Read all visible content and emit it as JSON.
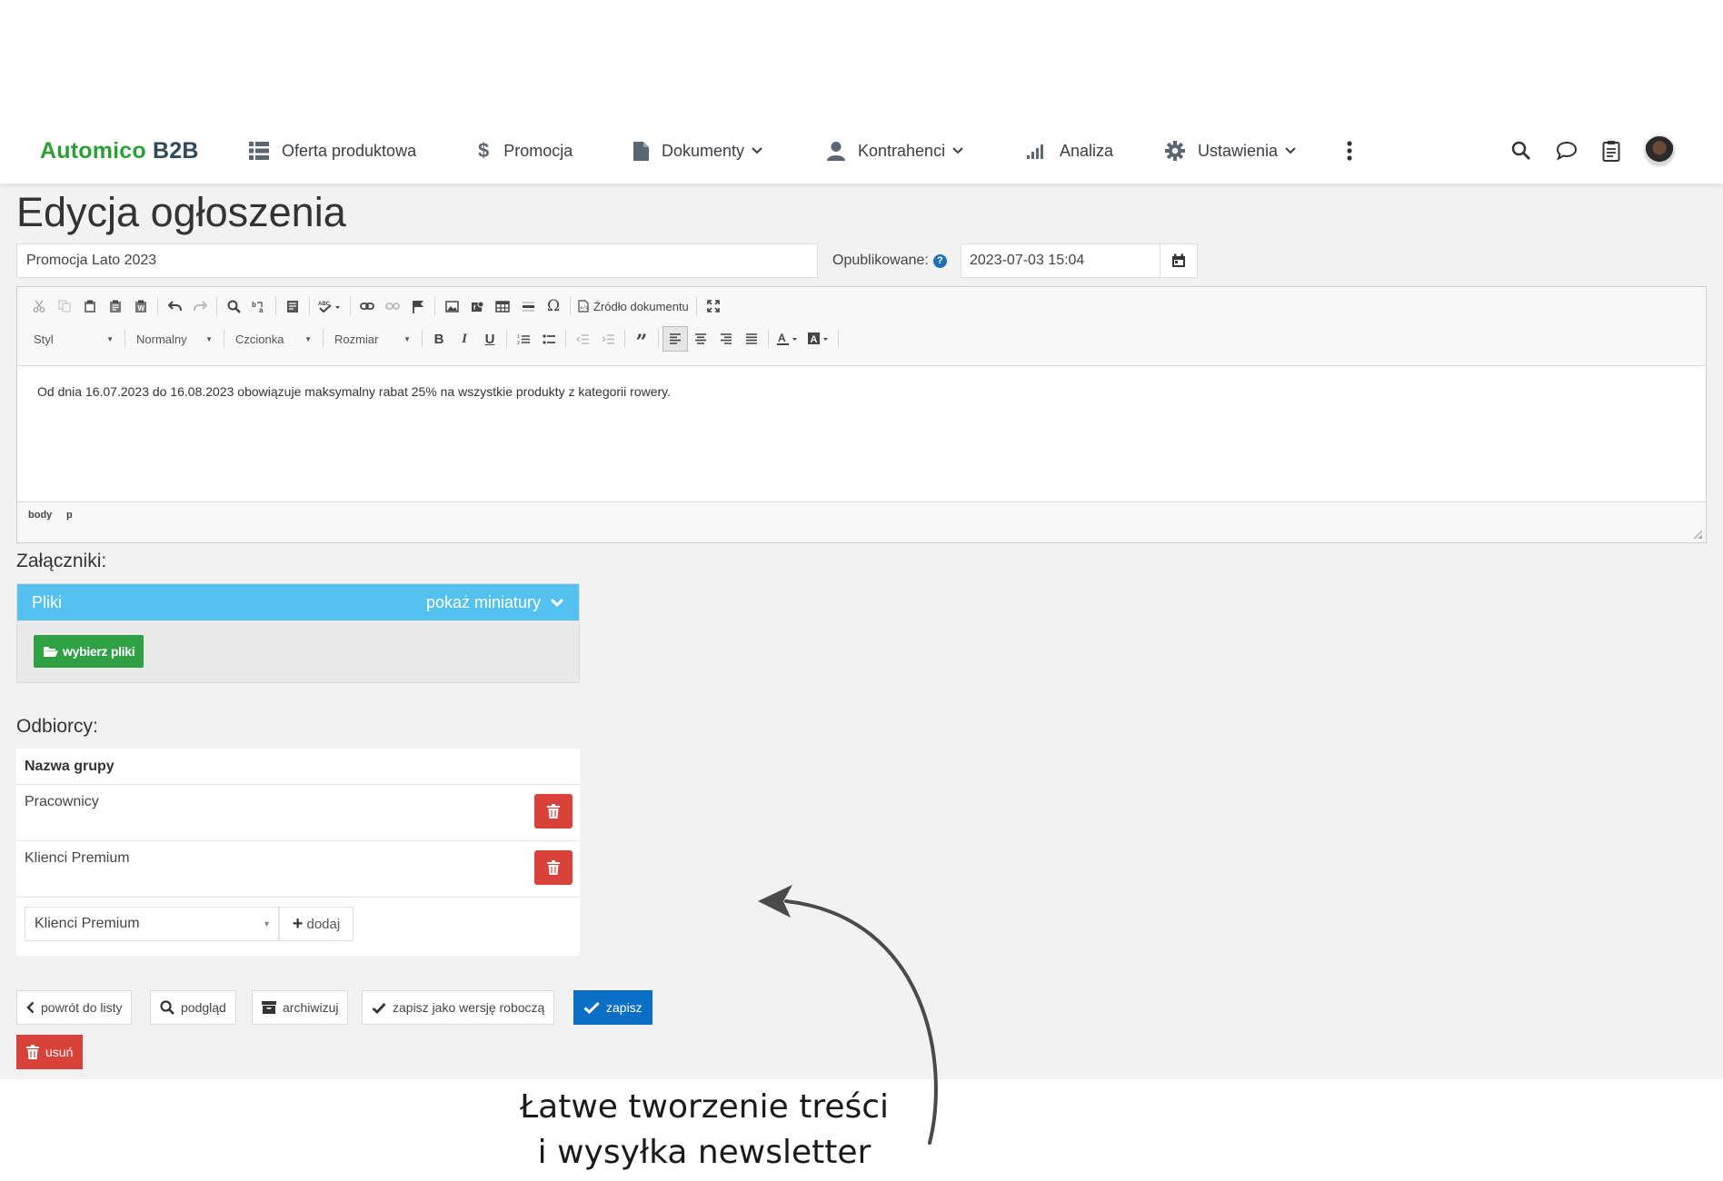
{
  "brand": {
    "part1": "Automico",
    "part2": "B2B"
  },
  "nav": {
    "items": [
      {
        "label": "Oferta produktowa",
        "icon": "grid-list-icon"
      },
      {
        "label": "Promocja",
        "icon": "dollar-icon"
      },
      {
        "label": "Dokumenty",
        "icon": "document-icon",
        "dropdown": true
      },
      {
        "label": "Kontrahenci",
        "icon": "user-icon",
        "dropdown": true
      },
      {
        "label": "Analiza",
        "icon": "signal-bars-icon"
      },
      {
        "label": "Ustawienia",
        "icon": "gear-icon",
        "dropdown": true
      }
    ],
    "more_icon": "kebab-menu-icon",
    "right_icons": [
      "search-icon",
      "chat-icon",
      "clipboard-icon",
      "avatar"
    ]
  },
  "page": {
    "title": "Edycja ogłoszenia",
    "announcement_title": "Promocja Lato 2023",
    "published_label": "Opublikowane:",
    "published_help": "?",
    "published_date": "2023-07-03 15:04"
  },
  "editor": {
    "source_label": "Źródło dokumentu",
    "combos": {
      "style": "Styl",
      "format": "Normalny",
      "font": "Czcionka",
      "size": "Rozmiar"
    },
    "content": "Od dnia 16.07.2023 do 16.08.2023 obowiązuje maksymalny rabat 25% na wszystkie produkty z kategorii rowery.",
    "path": [
      "body",
      "p"
    ]
  },
  "attachments": {
    "label": "Załączniki:",
    "panel_title": "Pliki",
    "toggle_label": "pokaż miniatury",
    "choose_button": "wybierz pliki"
  },
  "recipients": {
    "label": "Odbiorcy:",
    "column_header": "Nazwa grupy",
    "groups": [
      "Pracownicy",
      "Klienci Premium"
    ],
    "select_value": "Klienci Premium",
    "add_button": "dodaj"
  },
  "actions": {
    "back": "powrót do listy",
    "preview": "podgląd",
    "archive": "archiwizuj",
    "save_draft": "zapisz jako wersję roboczą",
    "save": "zapisz",
    "delete": "usuń"
  },
  "caption": {
    "line1": "Łatwe tworzenie treści",
    "line2": "i wysyłka newsletter"
  },
  "colors": {
    "brand_green": "#2e9d3a",
    "brand_dark": "#2f4a5a",
    "panel_blue": "#54c1f0",
    "primary_blue": "#0a6fc2",
    "danger_red": "#d9423a",
    "success_green": "#2fa043"
  }
}
